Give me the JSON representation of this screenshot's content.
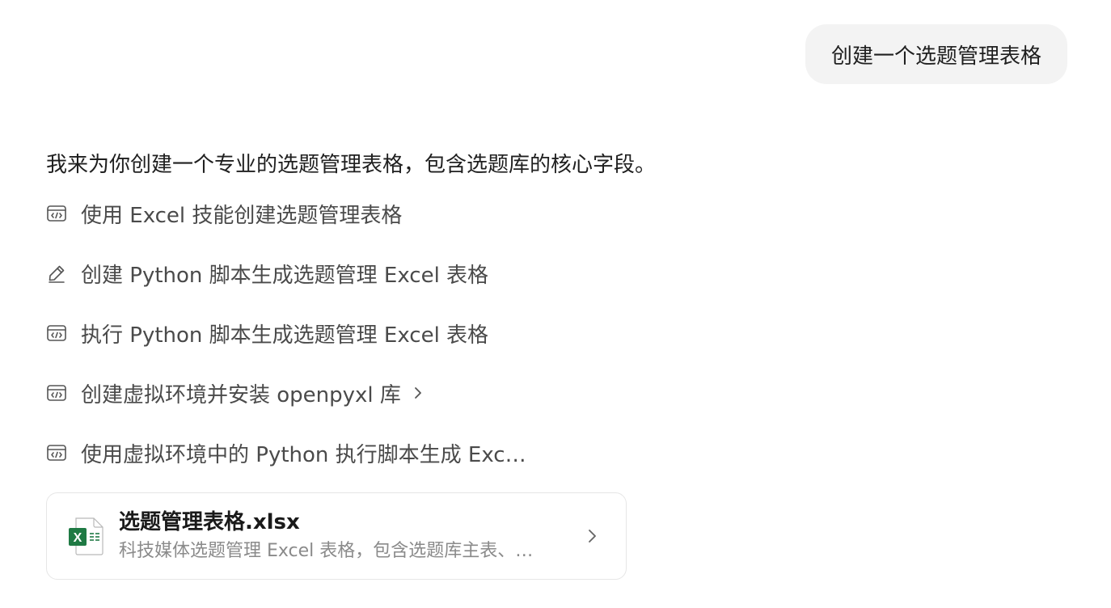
{
  "user_message": {
    "text": "创建一个选题管理表格"
  },
  "assistant": {
    "intro": "我来为你创建一个专业的选题管理表格，包含选题库的核心字段。",
    "steps": [
      {
        "icon": "code-terminal-icon",
        "label": "使用 Excel 技能创建选题管理表格",
        "expandable": false
      },
      {
        "icon": "pencil-edit-icon",
        "label": "创建 Python 脚本生成选题管理 Excel 表格",
        "expandable": false
      },
      {
        "icon": "code-terminal-icon",
        "label": "执行 Python 脚本生成选题管理 Excel 表格",
        "expandable": false
      },
      {
        "icon": "code-terminal-icon",
        "label": "创建虚拟环境并安装 openpyxl 库",
        "expandable": true
      },
      {
        "icon": "code-terminal-icon",
        "label": "使用虚拟环境中的 Python 执行脚本生成 Exc…",
        "expandable": false
      }
    ],
    "file_card": {
      "name": "选题管理表格.xlsx",
      "description": "科技媒体选题管理 Excel 表格，包含选题库主表、…",
      "icon": "excel-file-icon",
      "icon_letter": "X",
      "icon_color": "#1f7a44"
    }
  },
  "colors": {
    "user_bubble_bg": "#f3f3f3",
    "step_text": "#4a4a4a",
    "muted_text": "#8a8a8a",
    "excel_green": "#1f7a44"
  }
}
